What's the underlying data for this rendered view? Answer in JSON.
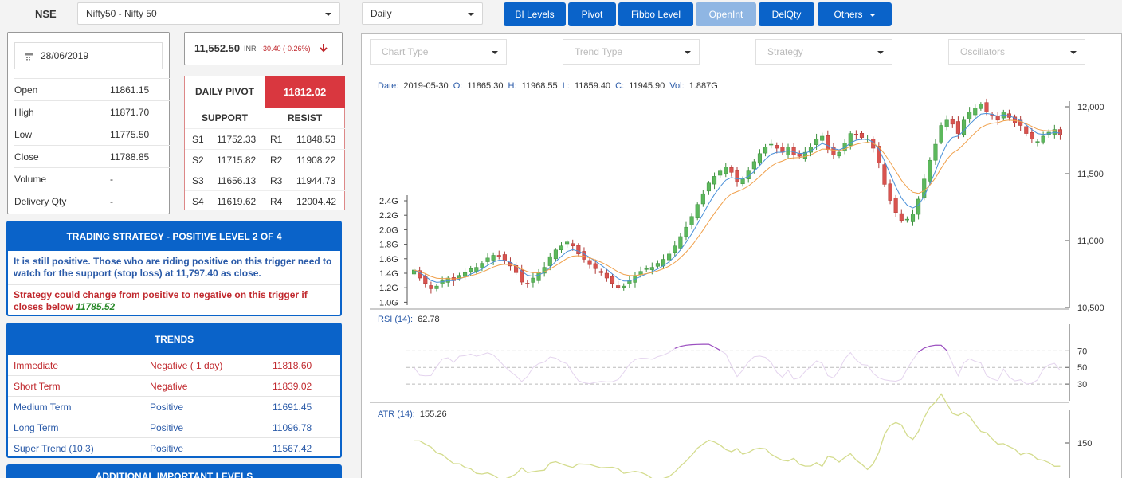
{
  "topbar": {
    "exchange": "NSE",
    "symbol_select": "Nifty50 - Nifty 50",
    "interval_select": "Daily",
    "buttons": [
      {
        "label": "BI Levels",
        "disabled": false
      },
      {
        "label": "Pivot",
        "disabled": false
      },
      {
        "label": "Fibbo Level",
        "disabled": false
      },
      {
        "label": "OpenInt",
        "disabled": true
      },
      {
        "label": "DelQty",
        "disabled": false
      },
      {
        "label": "Others",
        "disabled": false
      }
    ]
  },
  "quote": {
    "date": "28/06/2019",
    "rows": [
      {
        "label": "Open",
        "value": "11861.15"
      },
      {
        "label": "High",
        "value": "11871.70"
      },
      {
        "label": "Low",
        "value": "11775.50"
      },
      {
        "label": "Close",
        "value": "11788.85"
      },
      {
        "label": "Volume",
        "value": "-"
      },
      {
        "label": "Delivery Qty",
        "value": "-"
      }
    ]
  },
  "ltp": {
    "price": "11,552.50",
    "currency": "INR",
    "change": "-30.40 (-0.26%)"
  },
  "pivot": {
    "title": "DAILY PIVOT",
    "value": "11812.02",
    "support_label": "SUPPORT",
    "resist_label": "RESIST",
    "rows": [
      {
        "s": "S1",
        "sv": "11752.33",
        "r": "R1",
        "rv": "11848.53"
      },
      {
        "s": "S2",
        "sv": "11715.82",
        "r": "R2",
        "rv": "11908.22"
      },
      {
        "s": "S3",
        "sv": "11656.13",
        "r": "R3",
        "rv": "11944.73"
      },
      {
        "s": "S4",
        "sv": "11619.62",
        "r": "R4",
        "rv": "12004.42"
      }
    ]
  },
  "strategy": {
    "title": "TRADING STRATEGY - POSITIVE LEVEL 2 OF 4",
    "text1": "It is still positive. Those who are riding positive on this trigger need to watch for the support (stop loss) at 11,797.40 as close.",
    "text2": "Strategy could change from positive to negative on this trigger if closes below",
    "level": "11785.52"
  },
  "trends": {
    "title": "TRENDS",
    "rows": [
      {
        "name": "Immediate",
        "status": "Negative ( 1 day)",
        "value": "11818.60",
        "color": "#c0282d"
      },
      {
        "name": "Short Term",
        "status": "Negative",
        "value": "11839.02",
        "color": "#c0282d"
      },
      {
        "name": "Medium Term",
        "status": "Positive",
        "value": "11691.45",
        "color": "#2a5aa8"
      },
      {
        "name": "Long Term",
        "status": "Positive",
        "value": "11096.78",
        "color": "#2a5aa8"
      },
      {
        "name": "Super Trend (10,3)",
        "status": "Positive",
        "value": "11567.42",
        "color": "#2a5aa8"
      }
    ]
  },
  "next_panel_title": "ADDITIONAL IMPORTANT LEVELS",
  "chart_controls": {
    "chart_type": "Chart Type",
    "trend_type": "Trend Type",
    "strategy": "Strategy",
    "oscillators": "Oscillators"
  },
  "chart_data": {
    "type": "candlestick",
    "info": {
      "date_label": "Date:",
      "date": "2019-05-30",
      "o_label": "O:",
      "o": "11865.30",
      "h_label": "H:",
      "h": "11968.55",
      "l_label": "L:",
      "l": "11859.40",
      "c_label": "C:",
      "c": "11945.90",
      "vol_label": "Vol:",
      "vol": "1.887G"
    },
    "price_ticks": [
      "12,000",
      "11,500",
      "11,000",
      "10,500"
    ],
    "price_tick_values": [
      12000,
      11500,
      11000,
      10500
    ],
    "price_range": [
      10500,
      12000
    ],
    "volume_ticks": [
      "2.4G",
      "2.2G",
      "2.0G",
      "1.8G",
      "1.6G",
      "1.4G",
      "1.2G",
      "1.0G"
    ],
    "closes": [
      10780,
      10720,
      10680,
      10640,
      10660,
      10700,
      10720,
      10700,
      10740,
      10760,
      10790,
      10800,
      10830,
      10870,
      10890,
      10880,
      10850,
      10810,
      10760,
      10690,
      10680,
      10720,
      10760,
      10800,
      10880,
      10930,
      10960,
      10990,
      10960,
      10900,
      10860,
      10820,
      10790,
      10760,
      10720,
      10680,
      10650,
      10660,
      10700,
      10740,
      10770,
      10790,
      10800,
      10830,
      10860,
      10900,
      10960,
      11030,
      11100,
      11180,
      11270,
      11350,
      11430,
      11480,
      11520,
      11550,
      11510,
      11440,
      11460,
      11520,
      11590,
      11650,
      11700,
      11720,
      11690,
      11660,
      11700,
      11640,
      11630,
      11660,
      11700,
      11760,
      11780,
      11680,
      11640,
      11660,
      11730,
      11800,
      11790,
      11770,
      11760,
      11690,
      11580,
      11420,
      11300,
      11210,
      11150,
      11160,
      11200,
      11310,
      11460,
      11600,
      11720,
      11860,
      11900,
      11870,
      11800,
      11900,
      11960,
      11990,
      12020,
      11960,
      11930,
      11900,
      11960,
      11920,
      11880,
      11860,
      11800,
      11760,
      11740,
      11780,
      11810,
      11830,
      11790
    ],
    "rsi": {
      "label": "RSI (14):",
      "value": "62.78",
      "ticks": [
        "70",
        "50",
        "30"
      ],
      "tick_values": [
        70,
        50,
        30
      ]
    },
    "atr": {
      "label": "ATR (14):",
      "value": "155.26",
      "ticks": [
        "150"
      ],
      "tick_values": [
        150
      ]
    }
  }
}
